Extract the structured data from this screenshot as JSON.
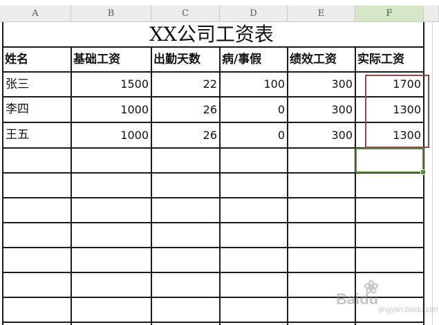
{
  "columns": [
    "A",
    "B",
    "C",
    "D",
    "E",
    "F"
  ],
  "title": "XX公司工资表",
  "headers": [
    "姓名",
    "基础工资",
    "出勤天数",
    "病/事假",
    "绩效工资",
    "实际工资"
  ],
  "rows": [
    [
      "张三",
      "1500",
      "22",
      "100",
      "300",
      "1700"
    ],
    [
      "李四",
      "1000",
      "26",
      "0",
      "300",
      "1300"
    ],
    [
      "王五",
      "1000",
      "26",
      "0",
      "300",
      "1300"
    ]
  ],
  "watermark": {
    "brand": "Baidu",
    "sub": "jingyan.baidu.com"
  }
}
